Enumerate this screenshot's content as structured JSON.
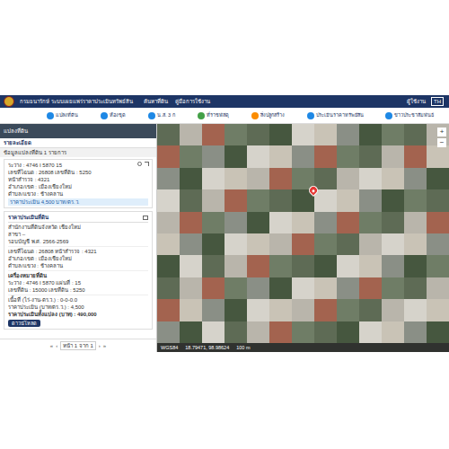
{
  "header": {
    "title": "กรมธนารักษ์ ระบบเผยแพร่ราคาประเมินทรัพย์สิน",
    "links": [
      "ค้นหาที่ดิน",
      "คู่มือการใช้งาน"
    ],
    "user": "ผู้ใช้งาน",
    "lang": "TH"
  },
  "toolbar": [
    {
      "label": "แปลงที่ดิน",
      "color": "#1e88e5"
    },
    {
      "label": "ห้องชุด",
      "color": "#1e88e5"
    },
    {
      "label": "น.ส. 3 ก",
      "color": "#1e88e5"
    },
    {
      "label": "ที่ราชพัสดุ",
      "color": "#43a047"
    },
    {
      "label": "สิ่งปลูกสร้าง",
      "color": "#fb8c00"
    },
    {
      "label": "ประเมินราคาทรัพย์สิน",
      "color": "#1e88e5"
    },
    {
      "label": "ข่าวประชาสัมพันธ์",
      "color": "#1e88e5"
    }
  ],
  "panel": {
    "banner": "แปลงที่ดิน",
    "heading": "รายละเอียด",
    "count": "ข้อมูลแปลงที่ดิน 1 รายการ",
    "details": [
      "ระวาง : 4746 I 5870 15",
      "เลขที่โฉนด : 26808 เลขที่ดิน : 5250",
      "หน้าสำรวจ : 4321",
      "อำเภอ/เขต : เมืองเชียงใหม่",
      "ตำบล/แขวง : ช้างคลาน"
    ],
    "price": "ราคาประเมิน 4,500 บาท/ตร.ว.",
    "appraisal_title": "ราคาประเมินที่ดิน",
    "office": [
      "สำนักงานที่ดินจังหวัด เชียงใหม่",
      "สาขา –",
      "รอบบัญชี พ.ศ. 2566-2569"
    ],
    "location": [
      "เลขที่โฉนด : 26808 หน้าสำรวจ : 4321",
      "อำเภอ/เขต : เมืองเชียงใหม่",
      "ตำบล/แขวง : ช้างคลาน"
    ],
    "marker_title": "เครื่องหมายที่ดิน",
    "marker": [
      "ระวาง : 4746 I 5870 แผ่นที่ : 15",
      "เลขที่ดิน : 15000 เลขที่ดิน : 5250"
    ],
    "result": [
      "เนื้อที่ (ไร่-งาน-ตร.ว.) : 0-0-0.0",
      "ราคาประเมิน (บาท/ตร.ว.) : 4,500",
      "ราคาประเมินทั้งแปลง (บาท) : 490,000"
    ],
    "download": "ดาวน์โหลด",
    "pagination": {
      "first": "«",
      "prev": "‹",
      "label": "หน้า 1 จาก 1",
      "next": "›",
      "last": "»"
    }
  },
  "map": {
    "marker_shown": true,
    "controls": [
      "+",
      "−"
    ],
    "status": [
      "WGS84",
      "18.79471, 98.98624",
      "100 m"
    ]
  }
}
